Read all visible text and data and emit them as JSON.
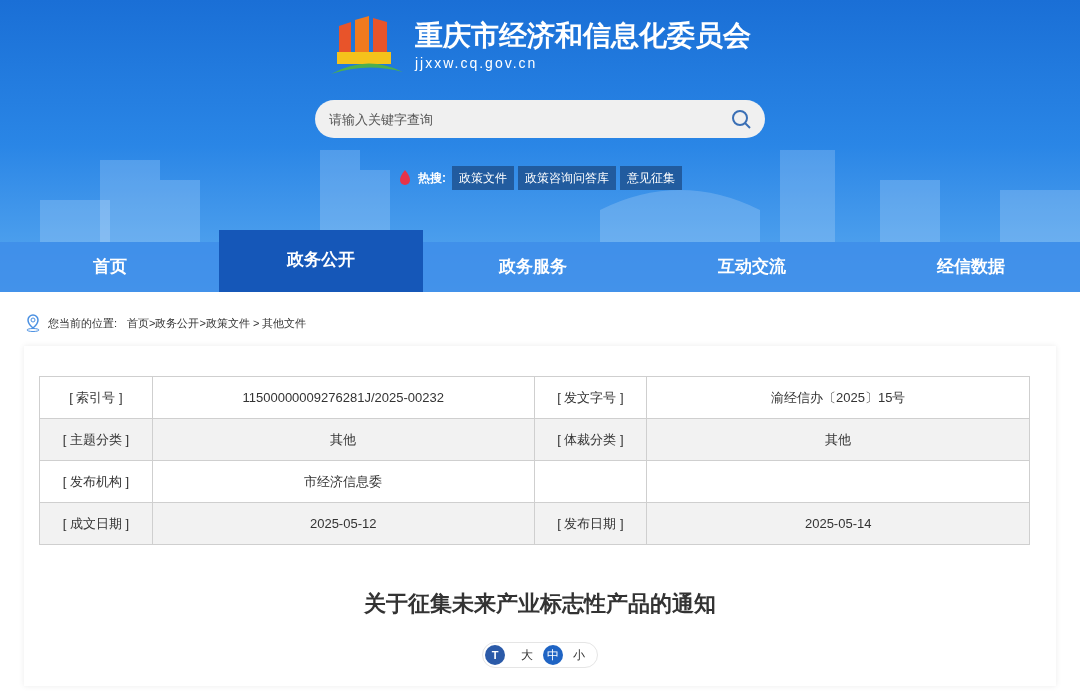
{
  "header": {
    "site_title": "重庆市经济和信息化委员会",
    "site_url": "jjxxw.cq.gov.cn",
    "search": {
      "placeholder": "请输入关键字查询"
    },
    "hot_label": "热搜:",
    "hot_tags": [
      "政策文件",
      "政策咨询问答库",
      "意见征集"
    ]
  },
  "nav": [
    {
      "label": "首页",
      "selected": false
    },
    {
      "label": "政务公开",
      "selected": true
    },
    {
      "label": "政务服务",
      "selected": false
    },
    {
      "label": "互动交流",
      "selected": false
    },
    {
      "label": "经信数据",
      "selected": false
    }
  ],
  "breadcrumb": {
    "label": "您当前的位置:",
    "path": "首页>政务公开>政策文件 > 其他文件"
  },
  "info_table": [
    {
      "cells": [
        "[ 索引号 ]",
        "11500000009276281J/2025-00232",
        "[ 发文字号 ]",
        "渝经信办〔2025〕15号"
      ]
    },
    {
      "cells": [
        "[ 主题分类 ]",
        "其他",
        "[ 体裁分类 ]",
        "其他"
      ]
    },
    {
      "cells": [
        "[ 发布机构 ]",
        "市经济信息委",
        "",
        ""
      ]
    },
    {
      "cells": [
        "[ 成文日期 ]",
        "2025-05-12",
        "[ 发布日期 ]",
        "2025-05-14"
      ]
    }
  ],
  "article_title": "关于征集未来产业标志性产品的通知",
  "font_size": {
    "icon_text": "T",
    "options": [
      {
        "label": "大",
        "selected": false
      },
      {
        "label": "中",
        "selected": true
      },
      {
        "label": "小",
        "selected": false
      }
    ]
  }
}
